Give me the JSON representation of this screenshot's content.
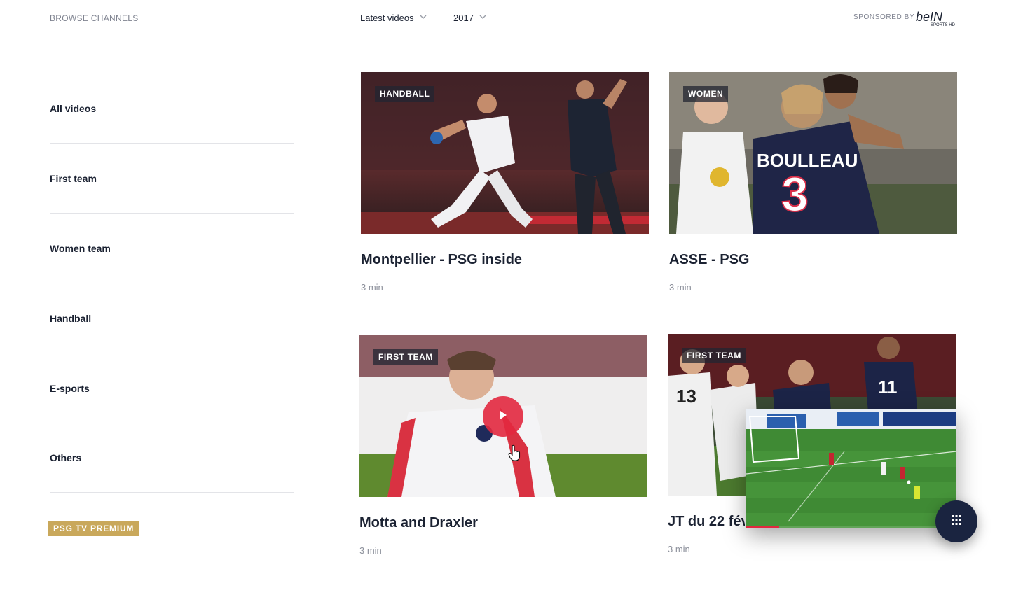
{
  "header": {
    "browse_label": "BROWSE CHANNELS",
    "filters": [
      {
        "label": "Latest videos"
      },
      {
        "label": "2017"
      }
    ],
    "sponsor_label": "SPONSORED BY",
    "sponsor_logo_text": "beIN",
    "sponsor_logo_sub": "SPORTS HD"
  },
  "sidebar": {
    "items": [
      {
        "label": "All videos"
      },
      {
        "label": "First team"
      },
      {
        "label": "Women team"
      },
      {
        "label": "Handball"
      },
      {
        "label": "E-sports"
      },
      {
        "label": "Others"
      }
    ],
    "premium_label": "PSG TV PREMIUM"
  },
  "videos": [
    {
      "tag": "HANDBALL",
      "title": "Montpellier - PSG inside",
      "duration": "3 min"
    },
    {
      "tag": "WOMEN",
      "title": "ASSE - PSG",
      "duration": "3 min"
    },
    {
      "tag": "FIRST TEAM",
      "title": "Motta and Draxler",
      "duration": "3 min"
    },
    {
      "tag": "FIRST TEAM",
      "title": "JT du 22 févr",
      "duration": "3 min"
    }
  ],
  "mini_player": {
    "progress": 0.155
  },
  "colors": {
    "accent_red": "#e2283f",
    "premium_gold": "#c9a85b",
    "navy": "#1a2440",
    "text_dark": "#1b2232",
    "text_muted": "#8c909b"
  },
  "icons": {
    "filter_chevron": "chevron-down-icon",
    "play": "play-icon",
    "cursor": "hand-cursor-icon",
    "menu": "grid-menu-icon"
  }
}
